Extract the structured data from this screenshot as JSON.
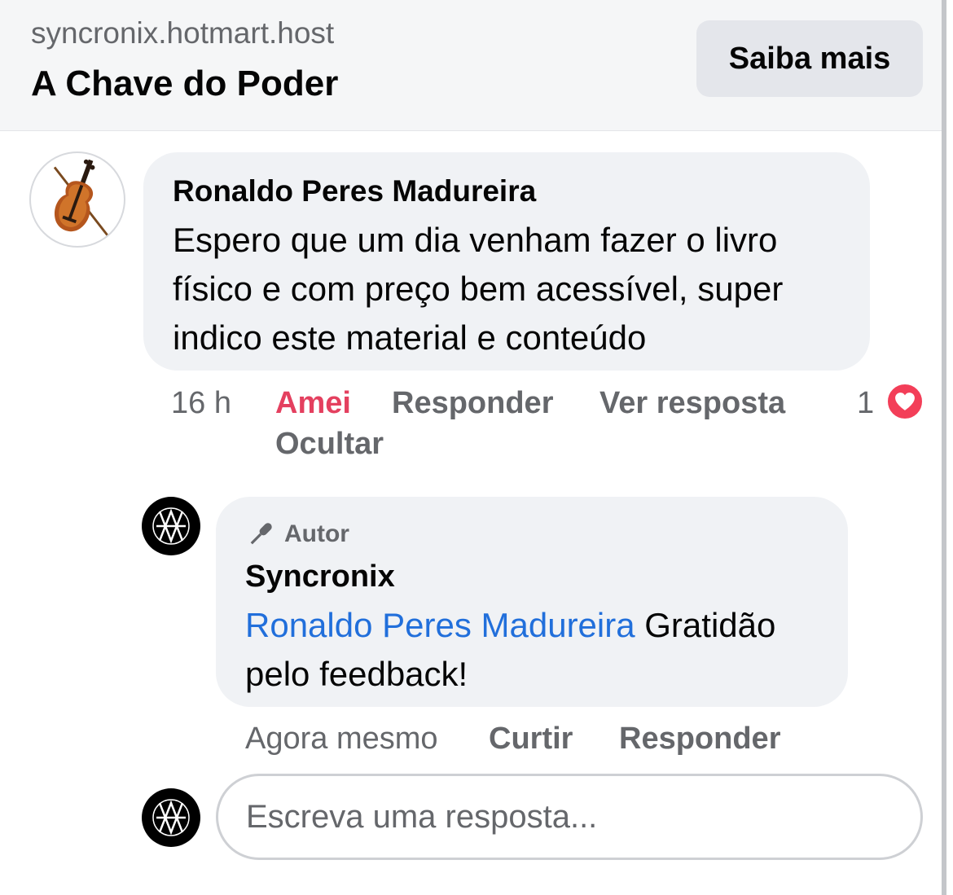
{
  "ad": {
    "domain": "syncronix.hotmart.host",
    "title": "A Chave do Poder",
    "cta_label": "Saiba mais"
  },
  "comment": {
    "author": "Ronaldo Peres Madureira",
    "text": "Espero que um dia venham fazer o livro físico e com preço bem acessível, super indico este material e conteúdo",
    "time": "16 h",
    "reaction_label": "Amei",
    "reply_label": "Responder",
    "view_reply_label": "Ver resposta",
    "hide_label": "Ocultar",
    "reaction_count": "1",
    "avatar_icon": "violin-icon"
  },
  "reply": {
    "badge_label": "Autor",
    "author": "Syncronix",
    "mention": "Ronaldo Peres Madureira",
    "text": " Gratidão pelo feedback!",
    "time": "Agora mesmo",
    "like_label": "Curtir",
    "reply_label": "Responder"
  },
  "composer": {
    "placeholder": "Escreva uma resposta..."
  },
  "colors": {
    "love": "#e4405f",
    "heart": "#f33e58",
    "mention": "#216fdb",
    "bubble": "#f0f2f5",
    "muted": "#65676b"
  }
}
